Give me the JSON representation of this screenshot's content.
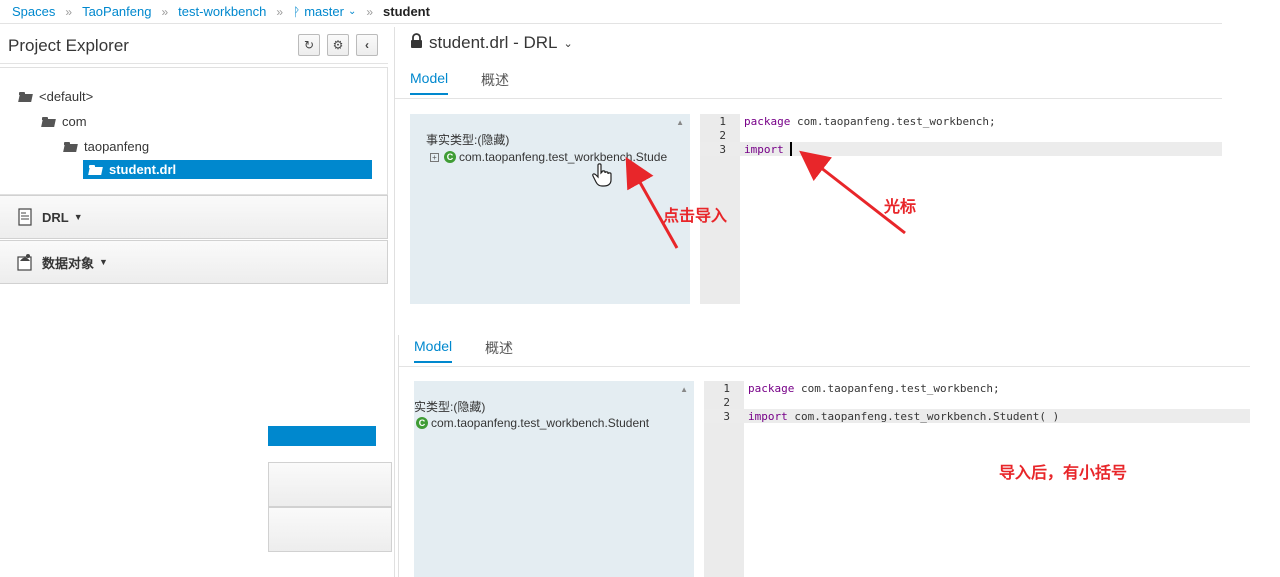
{
  "breadcrumb": {
    "spaces": "Spaces",
    "space": "TaoPanfeng",
    "project": "test-workbench",
    "branch": "master",
    "current": "student"
  },
  "project_explorer": {
    "title": "Project Explorer",
    "tree": {
      "root": "<default>",
      "level1": "com",
      "level2": "taopanfeng",
      "selected_file": "student.drl"
    },
    "accordion": {
      "drl": "DRL",
      "data_objects": "数据对象"
    }
  },
  "editor": {
    "title": "student.drl - DRL",
    "tabs": {
      "model": "Model",
      "overview": "概述"
    }
  },
  "panel_top": {
    "facts_label": "事实类型:(隐藏)",
    "fact_item": "com.taopanfeng.test_workbench.Stude",
    "lines": [
      "1",
      "2",
      "3"
    ],
    "code": {
      "line1_kw": "package",
      "line1_rest": " com.taopanfeng.test_workbench;",
      "line3_kw": "import"
    }
  },
  "panel_bottom": {
    "facts_label": "实类型:(隐藏)",
    "fact_item": "com.taopanfeng.test_workbench.Student",
    "lines": [
      "1",
      "2",
      "3"
    ],
    "code": {
      "line1_kw": "package",
      "line1_rest": " com.taopanfeng.test_workbench;",
      "line3_kw": "import",
      "line3_rest": " com.taopanfeng.test_workbench.Student( )"
    }
  },
  "annotations": {
    "click_import": "点击导入",
    "cursor": "光标",
    "after_import": "导入后，有小括号"
  },
  "colors": {
    "accent": "#0088ce",
    "annotation": "#e8262a",
    "facts_bg": "#e4edf2",
    "class_icon": "#3f9c35"
  }
}
